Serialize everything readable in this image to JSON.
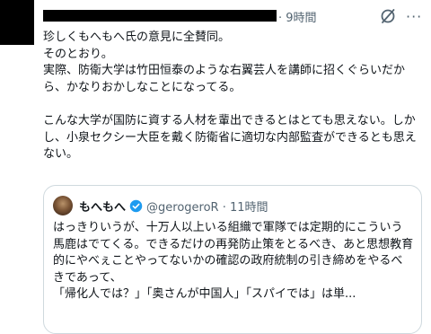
{
  "post": {
    "meta": "· 9時間",
    "grok_icon": "slashed-circle-icon",
    "more_icon": "ellipsis-icon",
    "more_glyph": "···",
    "text": "珍しくもへもへ氏の意見に全賛同。\nそのとおり。\n実際、防衛大学は竹田恒泰のような右翼芸人を講師に招くぐらいだから、かなりおかしなことになってる。\n\nこんな大学が国防に資する人材を輩出できるとはとても思えない。しかし、小泉セクシー大臣を戴く防衛省に適切な内部監査ができるとも思えない。"
  },
  "quote": {
    "name": "もへもへ",
    "verified_color": "#1d9bf0",
    "handle_time": "@gerogeroR · 11時間",
    "text": "はっきりいうが、十万人以上いる組織で軍隊では定期的にこういう馬鹿はでてくる。できるだけの再発防止策をとるべき、あと思想教育的にやべぇことやってないかの確認の政府統制の引き締めをやるべきであって、\n「帰化人では？」「奥さんが中国人」「スパイでは」は単..."
  }
}
